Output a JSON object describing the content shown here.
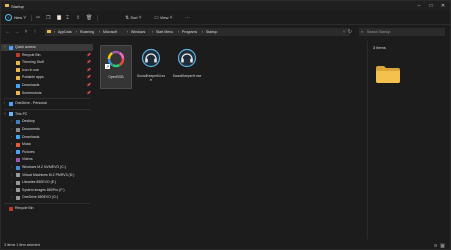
{
  "window": {
    "title": "Startup",
    "controls": [
      "–",
      "□",
      "✕"
    ]
  },
  "toolbar": {
    "new_label": "New",
    "sort_label": "Sort",
    "view_label": "View"
  },
  "address": {
    "breadcrumbs": [
      "AppData",
      "Roaming",
      "Microsoft",
      "Windows",
      "Start Menu",
      "Programs",
      "Startup"
    ],
    "search_placeholder": "Search Startup"
  },
  "sidebar": {
    "quick_access": [
      {
        "label": "Quick access",
        "color": "#4aa3ff",
        "level": 0,
        "expanded": true,
        "selected": true
      },
      {
        "label": "Recycle Bin",
        "color": "#c0392b",
        "level": 1,
        "pinned": true
      },
      {
        "label": "Theming Stuff",
        "color": "#e8b84a",
        "level": 1,
        "pinned": true
      },
      {
        "label": "Icon in use",
        "color": "#e8b84a",
        "level": 1,
        "pinned": true
      },
      {
        "label": "Portable apps",
        "color": "#e8b84a",
        "level": 1,
        "pinned": true
      },
      {
        "label": "Downloads",
        "color": "#3fa9f5",
        "level": 1,
        "pinned": true
      },
      {
        "label": "Screenshots",
        "color": "#e8b84a",
        "level": 1,
        "pinned": true
      }
    ],
    "onedrive": {
      "label": "OneDrive - Personal",
      "color": "#4aa3ff"
    },
    "this_pc": {
      "label": "This PC",
      "color": "#6cb6ff"
    },
    "pc_items": [
      {
        "label": "Desktop",
        "color": "#3f7fbf"
      },
      {
        "label": "Documents",
        "color": "#8a8a8a"
      },
      {
        "label": "Downloads",
        "color": "#3fa9f5"
      },
      {
        "label": "Music",
        "color": "#e65c3a"
      },
      {
        "label": "Pictures",
        "color": "#4aa3ff"
      },
      {
        "label": "Videos",
        "color": "#9b59b6"
      },
      {
        "label": "Windows M.2 NVMEVO (C:)",
        "color": "#3f8fd8"
      },
      {
        "label": "Virtual Machines M.2 PMRV3 (D:)",
        "color": "#9a9a9a"
      },
      {
        "label": "Libraries 850EVO (E:)",
        "color": "#9a9a9a"
      },
      {
        "label": "System images 860Pro (F:)",
        "color": "#9a9a9a"
      },
      {
        "label": "OneDrive 850EVO (G:)",
        "color": "#9a9a9a"
      }
    ],
    "recycle_bin": {
      "label": "Recycle Bin",
      "color": "#c0392b"
    }
  },
  "files": [
    {
      "name": "OpenRGB",
      "icon": "openrgb-icon",
      "selected": true,
      "shortcut": true
    },
    {
      "name": "SoundKeeper64.exe",
      "icon": "soundkeeper-icon",
      "selected": false,
      "shortcut": false
    },
    {
      "name": "SoundKeeperH.exe",
      "icon": "soundkeeper-icon",
      "selected": false,
      "shortcut": false
    }
  ],
  "preview": {
    "count_label": "3 items"
  },
  "status": {
    "text": "3 items  1 item selected"
  },
  "colors": {
    "background": "#1c1c1c",
    "folder": "#e8b84a",
    "accent": "#4fc3f7"
  }
}
